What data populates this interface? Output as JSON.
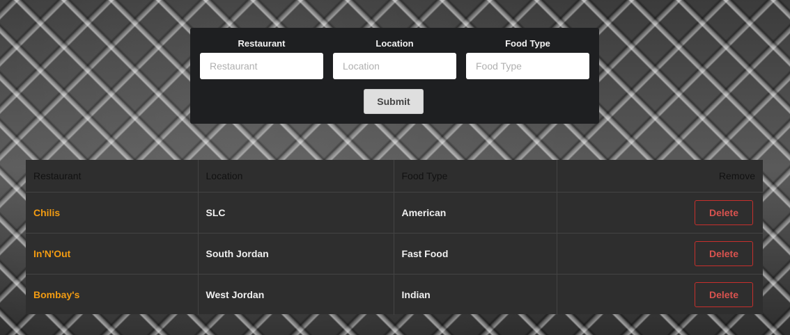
{
  "form": {
    "fields": [
      {
        "label": "Restaurant",
        "placeholder": "Restaurant",
        "value": ""
      },
      {
        "label": "Location",
        "placeholder": "Location",
        "value": ""
      },
      {
        "label": "Food Type",
        "placeholder": "Food Type",
        "value": ""
      }
    ],
    "submit_label": "Submit"
  },
  "table": {
    "headers": [
      "Restaurant",
      "Location",
      "Food Type",
      "Remove"
    ],
    "rows": [
      {
        "restaurant": "Chilis",
        "location": "SLC",
        "food_type": "American",
        "action": "Delete"
      },
      {
        "restaurant": "In'N'Out",
        "location": "South Jordan",
        "food_type": "Fast Food",
        "action": "Delete"
      },
      {
        "restaurant": "Bombay's",
        "location": "West Jordan",
        "food_type": "Indian",
        "action": "Delete"
      }
    ]
  },
  "colors": {
    "panel_bg": "#1e1f21",
    "table_bg": "#2e2e2e",
    "restaurant_text": "#f39c12",
    "delete_text": "#d9534f"
  }
}
